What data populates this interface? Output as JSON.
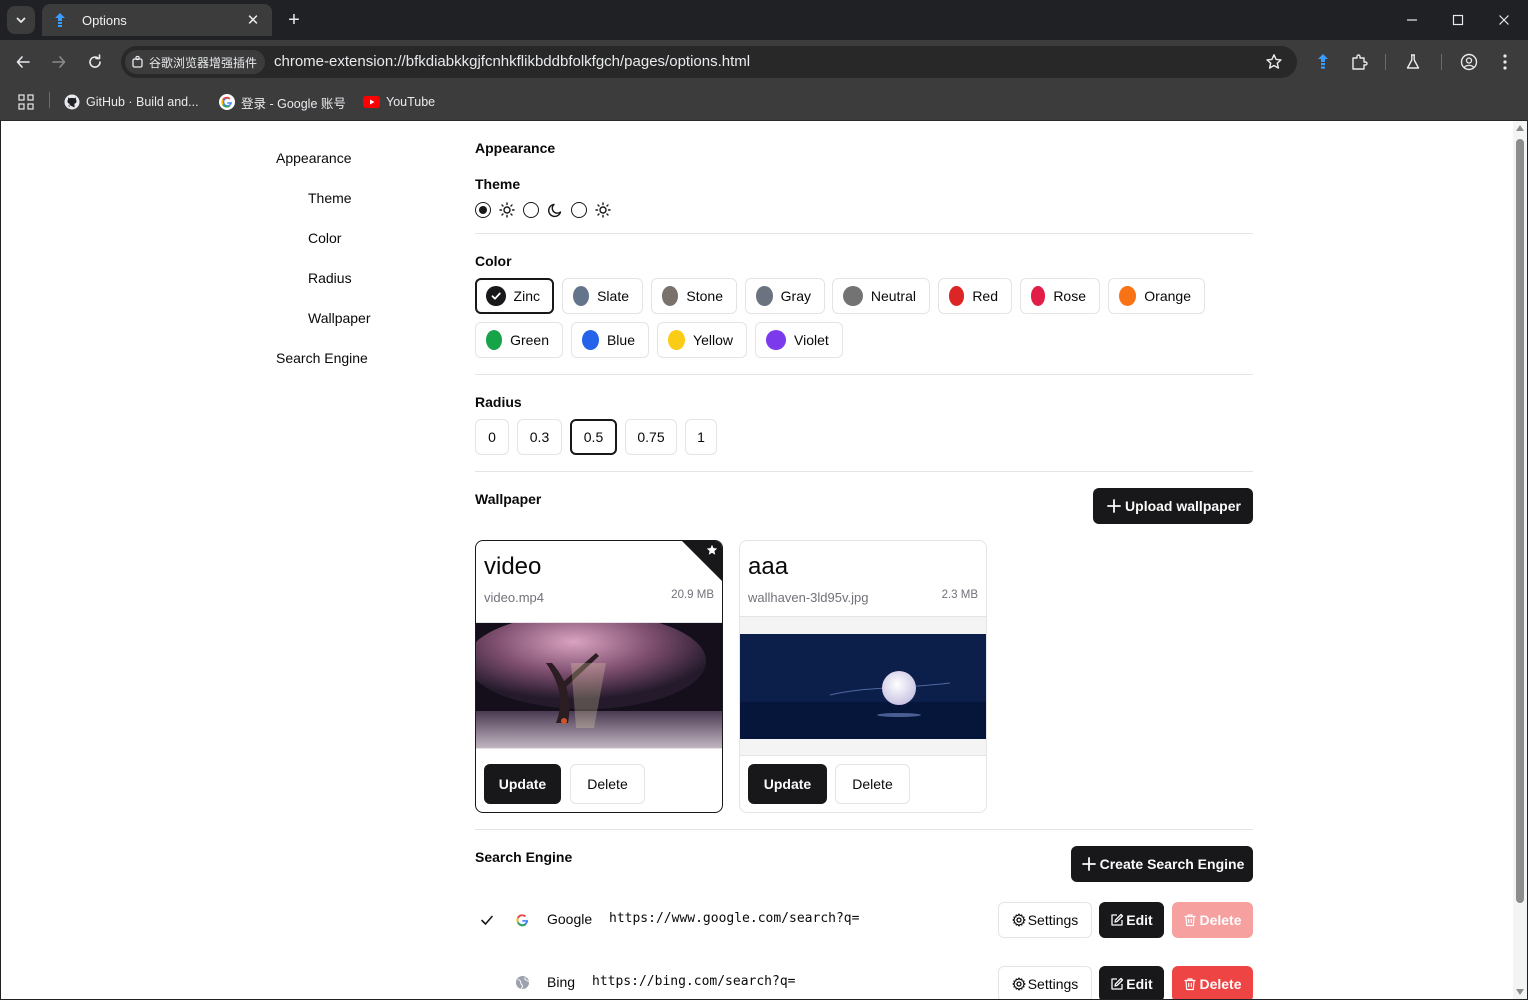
{
  "browser": {
    "tab_title": "Options",
    "extension_chip": "谷歌浏览器增强插件",
    "url": "chrome-extension://bfkdiabkkgjfcnhkflikbddbfolkfgch/pages/options.html",
    "bookmarks": [
      {
        "label": "GitHub · Build and...",
        "icon": "github-icon"
      },
      {
        "label": "登录 - Google 账号",
        "icon": "google-icon"
      },
      {
        "label": "YouTube",
        "icon": "youtube-icon"
      }
    ]
  },
  "sidebar": {
    "appearance": "Appearance",
    "theme": "Theme",
    "color": "Color",
    "radius": "Radius",
    "wallpaper": "Wallpaper",
    "search_engine": "Search Engine"
  },
  "appearance": {
    "title": "Appearance",
    "theme_label": "Theme",
    "theme_options": [
      {
        "icon": "sun-icon",
        "selected": true
      },
      {
        "icon": "moon-icon",
        "selected": false
      },
      {
        "icon": "sun-icon",
        "selected": false
      }
    ],
    "color_label": "Color",
    "colors": [
      {
        "label": "Zinc",
        "hex": "#18181b",
        "selected": true
      },
      {
        "label": "Slate",
        "hex": "#64748b"
      },
      {
        "label": "Stone",
        "hex": "#78716c"
      },
      {
        "label": "Gray",
        "hex": "#6b7280"
      },
      {
        "label": "Neutral",
        "hex": "#737373"
      },
      {
        "label": "Red",
        "hex": "#dc2626"
      },
      {
        "label": "Rose",
        "hex": "#e11d48"
      },
      {
        "label": "Orange",
        "hex": "#f97316"
      },
      {
        "label": "Green",
        "hex": "#16a34a"
      },
      {
        "label": "Blue",
        "hex": "#2563eb"
      },
      {
        "label": "Yellow",
        "hex": "#facc15"
      },
      {
        "label": "Violet",
        "hex": "#7c3aed"
      }
    ],
    "radius_label": "Radius",
    "radius_options": [
      "0",
      "0.3",
      "0.5",
      "0.75",
      "1"
    ],
    "radius_selected": "0.5"
  },
  "wallpaper": {
    "title": "Wallpaper",
    "upload_label": "Upload wallpaper",
    "cards": [
      {
        "title": "video",
        "file": "video.mp4",
        "size": "20.9 MB",
        "active": true,
        "update_label": "Update",
        "delete_label": "Delete"
      },
      {
        "title": "aaa",
        "file": "wallhaven-3ld95v.jpg",
        "size": "2.3 MB",
        "active": false,
        "update_label": "Update",
        "delete_label": "Delete"
      }
    ]
  },
  "search_engine": {
    "title": "Search Engine",
    "create_label": "Create Search Engine",
    "engines": [
      {
        "name": "Google",
        "url": "https://www.google.com/search?q=",
        "default": true,
        "settings_label": "Settings",
        "edit_label": "Edit",
        "delete_label": "Delete",
        "delete_disabled": true
      },
      {
        "name": "Bing",
        "url": "https://bing.com/search?q=",
        "default": false,
        "settings_label": "Settings",
        "edit_label": "Edit",
        "delete_label": "Delete",
        "delete_disabled": false
      }
    ]
  }
}
